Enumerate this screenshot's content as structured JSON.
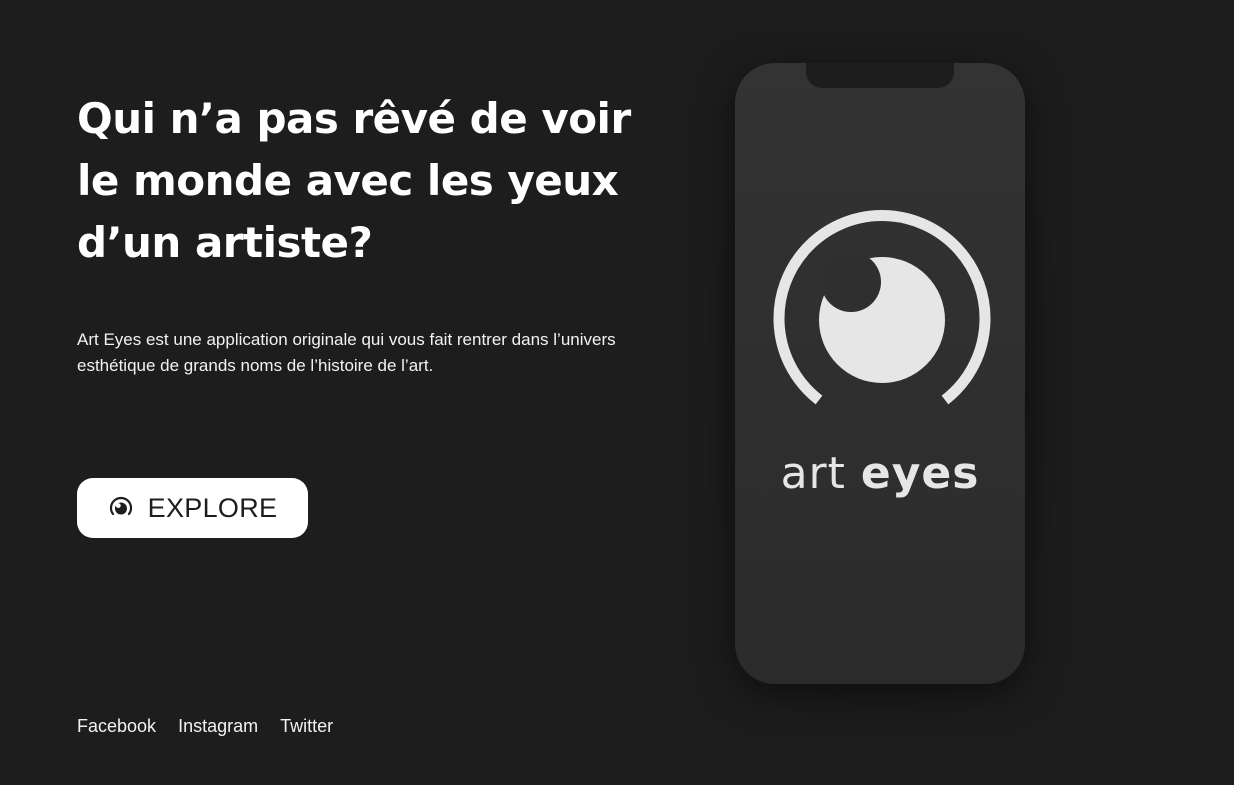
{
  "hero": {
    "headline": "Qui n’a pas rêvé de voir le monde avec les yeux d’un artiste?",
    "intro": "Art Eyes est une application originale qui vous fait rentrer dans l’univers esthétique de grands noms de l’histoire de l’art.",
    "explore_label": "EXPLORE",
    "explore_icon": "eye-icon"
  },
  "social": {
    "links": [
      "Facebook",
      "Instagram",
      "Twitter"
    ]
  },
  "phone": {
    "brand_light": "art",
    "brand_bold": "eyes",
    "logo_icon": "eye-logo-icon"
  },
  "colors": {
    "background": "#1d1d1d",
    "button_bg": "#ffffff",
    "phone_body": "#303030",
    "logo": "#e6e6e6"
  }
}
